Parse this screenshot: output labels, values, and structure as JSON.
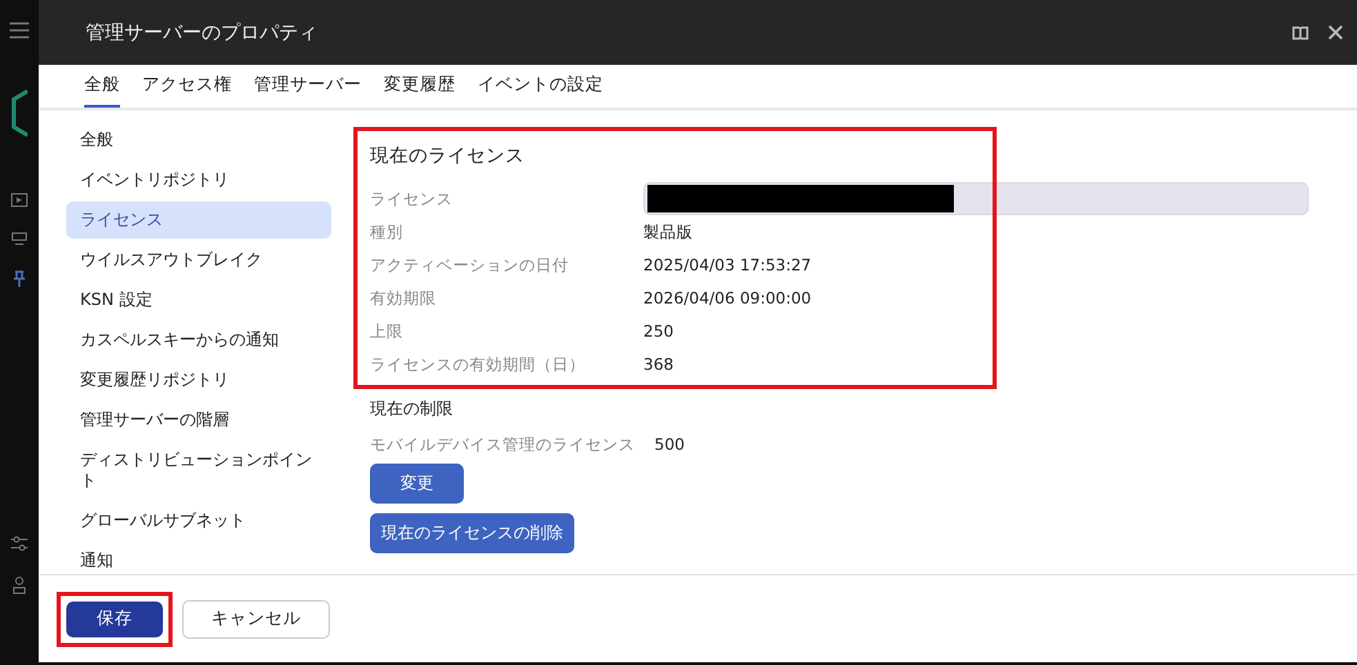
{
  "dialog": {
    "title": "管理サーバーのプロパティ"
  },
  "tabs": [
    {
      "label": "全般",
      "selected": true
    },
    {
      "label": "アクセス権",
      "selected": false
    },
    {
      "label": "管理サーバー",
      "selected": false
    },
    {
      "label": "変更履歴",
      "selected": false
    },
    {
      "label": "イベントの設定",
      "selected": false
    }
  ],
  "sidebar": {
    "items": [
      {
        "label": "全般",
        "selected": false
      },
      {
        "label": "イベントリポジトリ",
        "selected": false
      },
      {
        "label": "ライセンス",
        "selected": true
      },
      {
        "label": "ウイルスアウトブレイク",
        "selected": false
      },
      {
        "label": "KSN 設定",
        "selected": false
      },
      {
        "label": "カスペルスキーからの通知",
        "selected": false
      },
      {
        "label": "変更履歴リポジトリ",
        "selected": false
      },
      {
        "label": "管理サーバーの階層",
        "selected": false
      },
      {
        "label": "ディストリビューションポイント",
        "selected": false
      },
      {
        "label": "グローバルサブネット",
        "selected": false
      },
      {
        "label": "通知",
        "selected": false
      }
    ]
  },
  "current_license": {
    "title": "現在のライセンス",
    "highlighted": true,
    "rows": [
      {
        "kind": "field",
        "label": "ライセンス",
        "redacted": true
      },
      {
        "kind": "text",
        "label": "種別",
        "value": "製品版"
      },
      {
        "kind": "text",
        "label": "アクティベーションの日付",
        "value": "2025/04/03 17:53:27"
      },
      {
        "kind": "text",
        "label": "有効期限",
        "value": "2026/04/06 09:00:00"
      },
      {
        "kind": "text",
        "label": "上限",
        "value": "250"
      },
      {
        "kind": "text",
        "label": "ライセンスの有効期間（日）",
        "value": "368"
      }
    ]
  },
  "current_limits": {
    "title": "現在の制限",
    "rows": [
      {
        "label": "モバイルデバイス管理のライセンス",
        "value": "500"
      }
    ],
    "buttons": [
      {
        "label": "変更"
      },
      {
        "label": "現在のライセンスの削除"
      }
    ]
  },
  "footer": {
    "buttons": [
      {
        "label": "保存",
        "kind": "primary",
        "highlighted": true
      },
      {
        "label": "キャンセル",
        "kind": "secondary",
        "highlighted": false
      }
    ]
  }
}
